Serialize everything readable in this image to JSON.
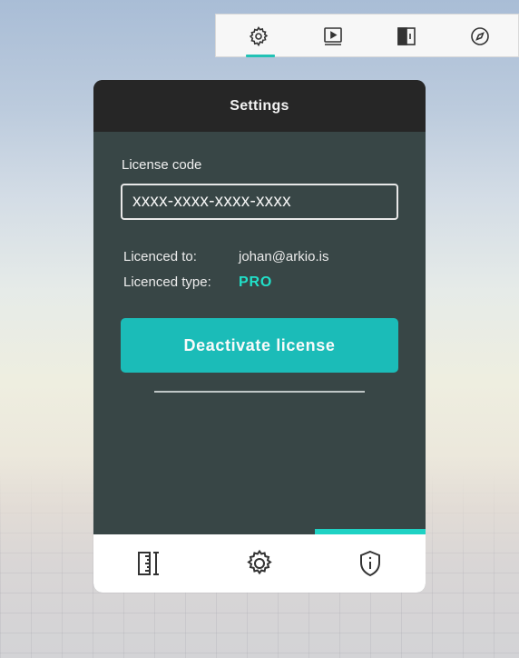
{
  "top_toolbar": {
    "tabs": [
      {
        "icon": "gear-icon",
        "active": true
      },
      {
        "icon": "video-player-icon",
        "active": false
      },
      {
        "icon": "panel-split-icon",
        "active": false
      },
      {
        "icon": "compass-icon",
        "active": false
      }
    ],
    "accent": "#22c2b5"
  },
  "panel": {
    "title": "Settings",
    "license_label": "License code",
    "license_value": "xxxx-xxxx-xxxx-xxxx",
    "licenced_to_label": "Licenced to:",
    "licenced_to_value": "johan@arkio.is",
    "licenced_type_label": "Licenced type:",
    "licenced_type_value": "PRO",
    "deactivate_label": "Deactivate license",
    "accent": "#1bbcb8",
    "pro_color": "#21e0c9"
  },
  "bottom_tabs": [
    {
      "icon": "measure-ruler-icon",
      "active": false
    },
    {
      "icon": "gear-icon",
      "active": false
    },
    {
      "icon": "shield-info-icon",
      "active": true
    }
  ]
}
